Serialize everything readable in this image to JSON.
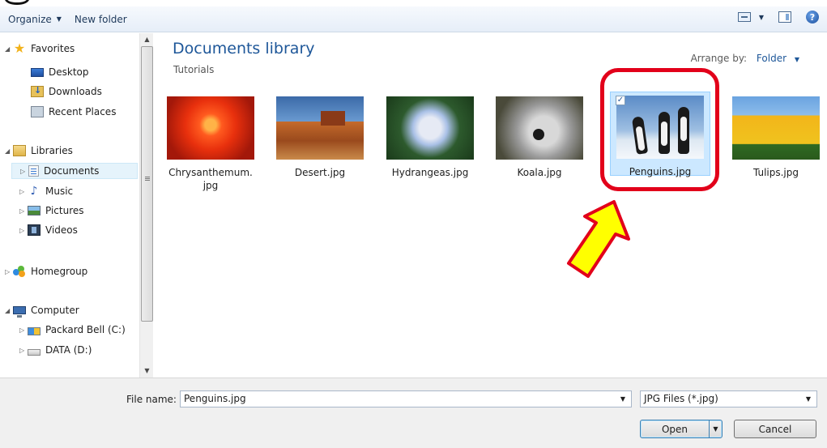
{
  "toolbar": {
    "organize_label": "Organize",
    "new_folder_label": "New folder"
  },
  "nav": {
    "favorites": {
      "label": "Favorites",
      "items": [
        "Desktop",
        "Downloads",
        "Recent Places"
      ]
    },
    "libraries": {
      "label": "Libraries",
      "items": [
        "Documents",
        "Music",
        "Pictures",
        "Videos"
      ],
      "selected": "Documents"
    },
    "homegroup": "Homegroup",
    "computer": {
      "label": "Computer",
      "items": [
        "Packard Bell (C:)",
        "DATA (D:)"
      ]
    }
  },
  "content": {
    "title": "Documents library",
    "subtitle": "Tutorials",
    "arrange_label": "Arrange by:",
    "arrange_value": "Folder",
    "files": [
      {
        "name_line1": "Chrysanthemum.",
        "name_line2": "jpg"
      },
      {
        "name_line1": "Desert.jpg"
      },
      {
        "name_line1": "Hydrangeas.jpg"
      },
      {
        "name_line1": "Koala.jpg"
      },
      {
        "name_line1": "Penguins.jpg",
        "selected": true
      },
      {
        "name_line1": "Tulips.jpg"
      }
    ]
  },
  "bottom": {
    "file_name_label": "File name:",
    "file_name_value": "Penguins.jpg",
    "filter_value": "JPG Files (*.jpg)",
    "open_label": "Open",
    "cancel_label": "Cancel"
  },
  "colors": {
    "accent": "#1e5799",
    "highlight_ring": "#e2001a",
    "arrow_fill": "#ffff00"
  }
}
